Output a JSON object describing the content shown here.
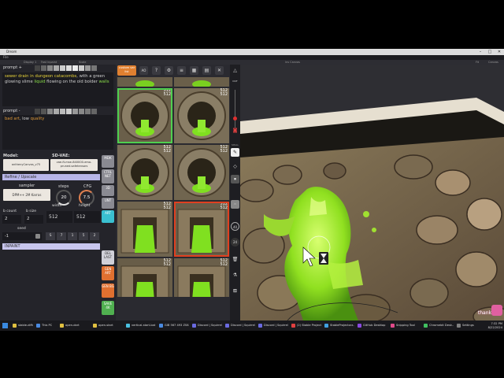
{
  "window": {
    "title": "Dream",
    "menu": [
      "File",
      "Edit",
      "Image",
      "Layer",
      "Help"
    ],
    "options": [
      "Display 1",
      "Fast inpaint",
      "Scale"
    ],
    "right_options": [
      "Fit",
      "Canvas"
    ],
    "center_option": "ins Canvas"
  },
  "prompt": {
    "label": "prompt +",
    "text_parts": [
      {
        "t": "sewer drain in dungeon catacombs",
        "c": "y"
      },
      {
        "t": ", with a green glowing slime ",
        "c": "n"
      },
      {
        "t": "liquid",
        "c": "g"
      },
      {
        "t": " flowing on the old bolder ",
        "c": "n"
      },
      {
        "t": "walls",
        "c": "g"
      }
    ]
  },
  "negative": {
    "label": "prompt -",
    "text_parts": [
      {
        "t": "bad art",
        "c": "o"
      },
      {
        "t": ", low ",
        "c": "n"
      },
      {
        "t": "quality",
        "c": "o"
      }
    ]
  },
  "model": {
    "label": "Model:",
    "value": "anthenyCanvas_v75",
    "vae_label": "SD-VAE:",
    "vae_value": "vae-ft-mse-840000-ema-pruned.safetensors"
  },
  "refine_label": "Refine / Upscale",
  "sampler": {
    "label": "sampler",
    "value": "DPM++ 2M Karras"
  },
  "steps": {
    "label": "steps",
    "value": "20"
  },
  "cfg": {
    "label": "CFG",
    "value": "7.5"
  },
  "batch": {
    "count_label": "b count",
    "count": "2",
    "size_label": "b size",
    "size": "2"
  },
  "width": {
    "label": "width",
    "value": "512"
  },
  "height": {
    "label": "height",
    "value": "512"
  },
  "seed": {
    "label": "seed",
    "value": "-1"
  },
  "seed_presets": [
    "S",
    "7",
    "1",
    "5",
    "2"
  ],
  "inpaint_label": "INPAINT",
  "side_buttons": [
    "MDK",
    "CTRL NET",
    "3D",
    "UNT",
    "ART"
  ],
  "side_buttons2": [
    "DEL LAST",
    "GEN ART",
    "GEN BG",
    "SAVE 4K"
  ],
  "grid": {
    "top_label": "custom var list",
    "tools": [
      "AO",
      "?",
      "⚙",
      "≡",
      "▦",
      "▤",
      "✕"
    ],
    "thumbs": [
      {
        "dim1": "512",
        "dim2": "512",
        "sel": "g"
      },
      {
        "dim1": "512",
        "dim2": "512",
        "sel": ""
      },
      {
        "dim1": "512",
        "dim2": "512",
        "sel": ""
      },
      {
        "dim1": "512",
        "dim2": "512",
        "sel": ""
      },
      {
        "dim1": "512",
        "dim2": "512",
        "sel": ""
      },
      {
        "dim1": "512",
        "dim2": "512",
        "sel": "r"
      },
      {
        "dim1": "512",
        "dim2": "512",
        "sel": ""
      },
      {
        "dim1": "512",
        "dim2": "512",
        "sel": ""
      }
    ]
  },
  "tools": {
    "labels": [
      "OUT",
      "SMALL",
      "40",
      "24"
    ]
  },
  "canvas": {
    "watermark": "thank"
  },
  "taskbar": {
    "items": [
      {
        "label": "stable-diffusion-...",
        "c": "#e0c040"
      },
      {
        "label": "This PC",
        "c": "#4a8ae0"
      },
      {
        "label": "open-dart",
        "c": "#e0c040"
      },
      {
        "label": "open-start",
        "c": "#e0c040"
      },
      {
        "label": "vertical-start-bat",
        "c": "#4ac0e0"
      },
      {
        "label": "GIB 567 493 ZS6...",
        "c": "#4a8ae0"
      },
      {
        "label": "Discord | Squirrel...",
        "c": "#6a6ae0"
      },
      {
        "label": "Discord | Squirrel...",
        "c": "#6a6ae0"
      },
      {
        "label": "Discord | Squirrel...",
        "c": "#6a6ae0"
      },
      {
        "label": "(2) Stable Project...",
        "c": "#e04040"
      },
      {
        "label": "StableProjectorz...",
        "c": "#40a0e0"
      },
      {
        "label": "GitHub Desktop",
        "c": "#8a4ae0"
      },
      {
        "label": "Snipping Tool",
        "c": "#e04a8a"
      },
      {
        "label": "Chromebit Desk...",
        "c": "#40c060"
      },
      {
        "label": "Settings",
        "c": "#808080"
      }
    ],
    "time": "7:32 PM",
    "date": "8/22/2024"
  }
}
